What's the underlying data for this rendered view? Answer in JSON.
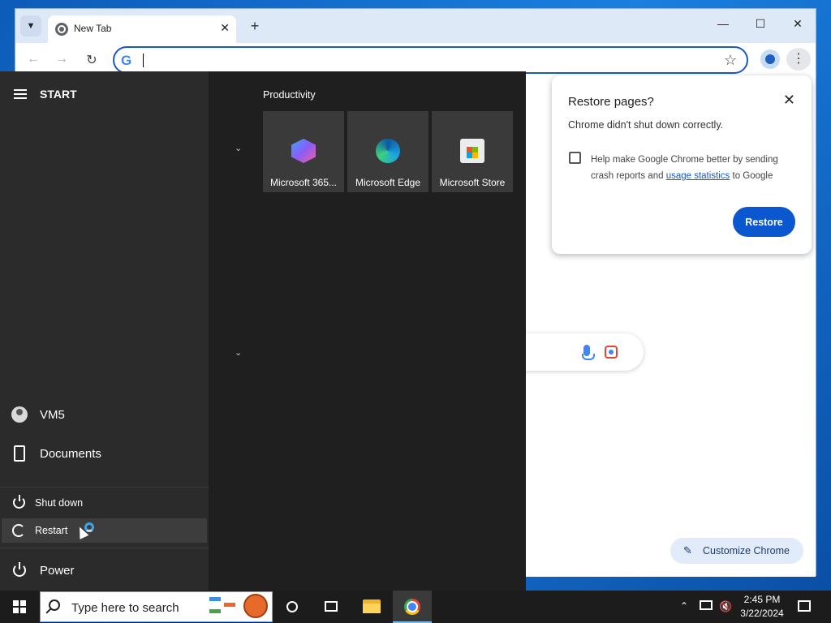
{
  "browser": {
    "tab_title": "New Tab",
    "new_tab_symbol": "+",
    "tab_close_symbol": "✕",
    "win_minimize": "—",
    "win_maximize": "☐",
    "win_close": "✕",
    "nav_back": "←",
    "nav_forward": "→",
    "nav_reload": "↻",
    "omnibox_g": "G",
    "star_symbol": "☆",
    "menu_symbol": "⋮",
    "customize_label": "Customize Chrome",
    "pencil_symbol": "✎"
  },
  "restore_dialog": {
    "title": "Restore pages?",
    "message": "Chrome didn't shut down correctly.",
    "checkbox_text_before": "Help make Google Chrome better by sending crash reports and ",
    "checkbox_link": "usage statistics",
    "checkbox_text_after": " to Google",
    "checkbox_checked": false,
    "button_label": "Restore",
    "close_symbol": "✕"
  },
  "start_menu": {
    "title": "START",
    "items": [
      {
        "label": "VM5",
        "icon": "user-icon"
      },
      {
        "label": "Documents",
        "icon": "document-icon"
      },
      {
        "label": "Power",
        "icon": "power-icon"
      }
    ],
    "power_submenu": [
      {
        "label": "Shut down",
        "icon": "power-icon"
      },
      {
        "label": "Restart",
        "icon": "restart-icon",
        "hovered": true
      }
    ],
    "group_name": "Productivity",
    "chevron_symbol": "⌄",
    "tiles": [
      {
        "label": "Microsoft 365...",
        "icon": "microsoft-365-icon"
      },
      {
        "label": "Microsoft Edge",
        "icon": "edge-icon"
      },
      {
        "label": "Microsoft Store",
        "icon": "store-icon"
      }
    ]
  },
  "taskbar": {
    "search_placeholder": "Type here to search",
    "time": "2:45 PM",
    "date": "3/22/2024",
    "tray_up_symbol": "⌃",
    "volume_symbol": "🔇",
    "accent": "#76b9ed"
  },
  "colors": {
    "restore_button": "#0b57d0",
    "start_left_bg": "#2b2b2b",
    "start_right_bg": "#1f1f1f",
    "tile_bg": "#3a3a3a"
  }
}
